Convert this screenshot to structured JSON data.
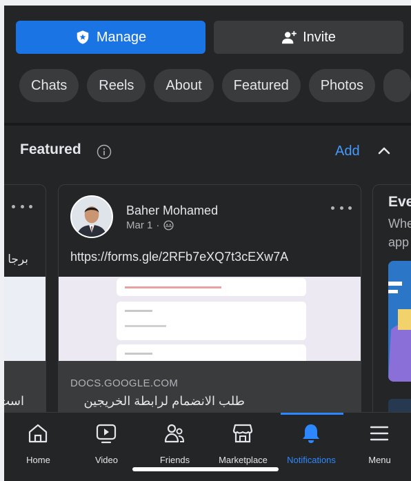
{
  "header": {
    "manage_label": "Manage",
    "invite_label": "Invite"
  },
  "tabs": [
    {
      "label": "Chats"
    },
    {
      "label": "Reels"
    },
    {
      "label": "About"
    },
    {
      "label": "Featured"
    },
    {
      "label": "Photos"
    }
  ],
  "featured": {
    "title": "Featured",
    "add_label": "Add",
    "left_card": {
      "text": "برجا",
      "bottom_text": "است"
    },
    "post": {
      "author": "Baher Mohamed",
      "date": "Mar 1",
      "separator": "·",
      "text": "https://forms.gle/2RFb7eXQ7t3cEXw7A",
      "link_domain": "DOCS.GOOGLE.COM",
      "link_title": "طلب الانضمام لرابطة الخريجين"
    },
    "right_card": {
      "title": "Eve",
      "subtitle_line1": "Whe",
      "subtitle_line2": "app"
    }
  },
  "nav": [
    {
      "label": "Home",
      "icon": "home-icon"
    },
    {
      "label": "Video",
      "icon": "video-icon"
    },
    {
      "label": "Friends",
      "icon": "friends-icon"
    },
    {
      "label": "Marketplace",
      "icon": "marketplace-icon"
    },
    {
      "label": "Notifications",
      "icon": "bell-icon",
      "active": true
    },
    {
      "label": "Menu",
      "icon": "menu-icon"
    }
  ],
  "colors": {
    "accent": "#1b74e4",
    "link": "#4599ff",
    "active_nav": "#2d88ff",
    "background": "#242526",
    "chip": "#3a3b3c"
  }
}
